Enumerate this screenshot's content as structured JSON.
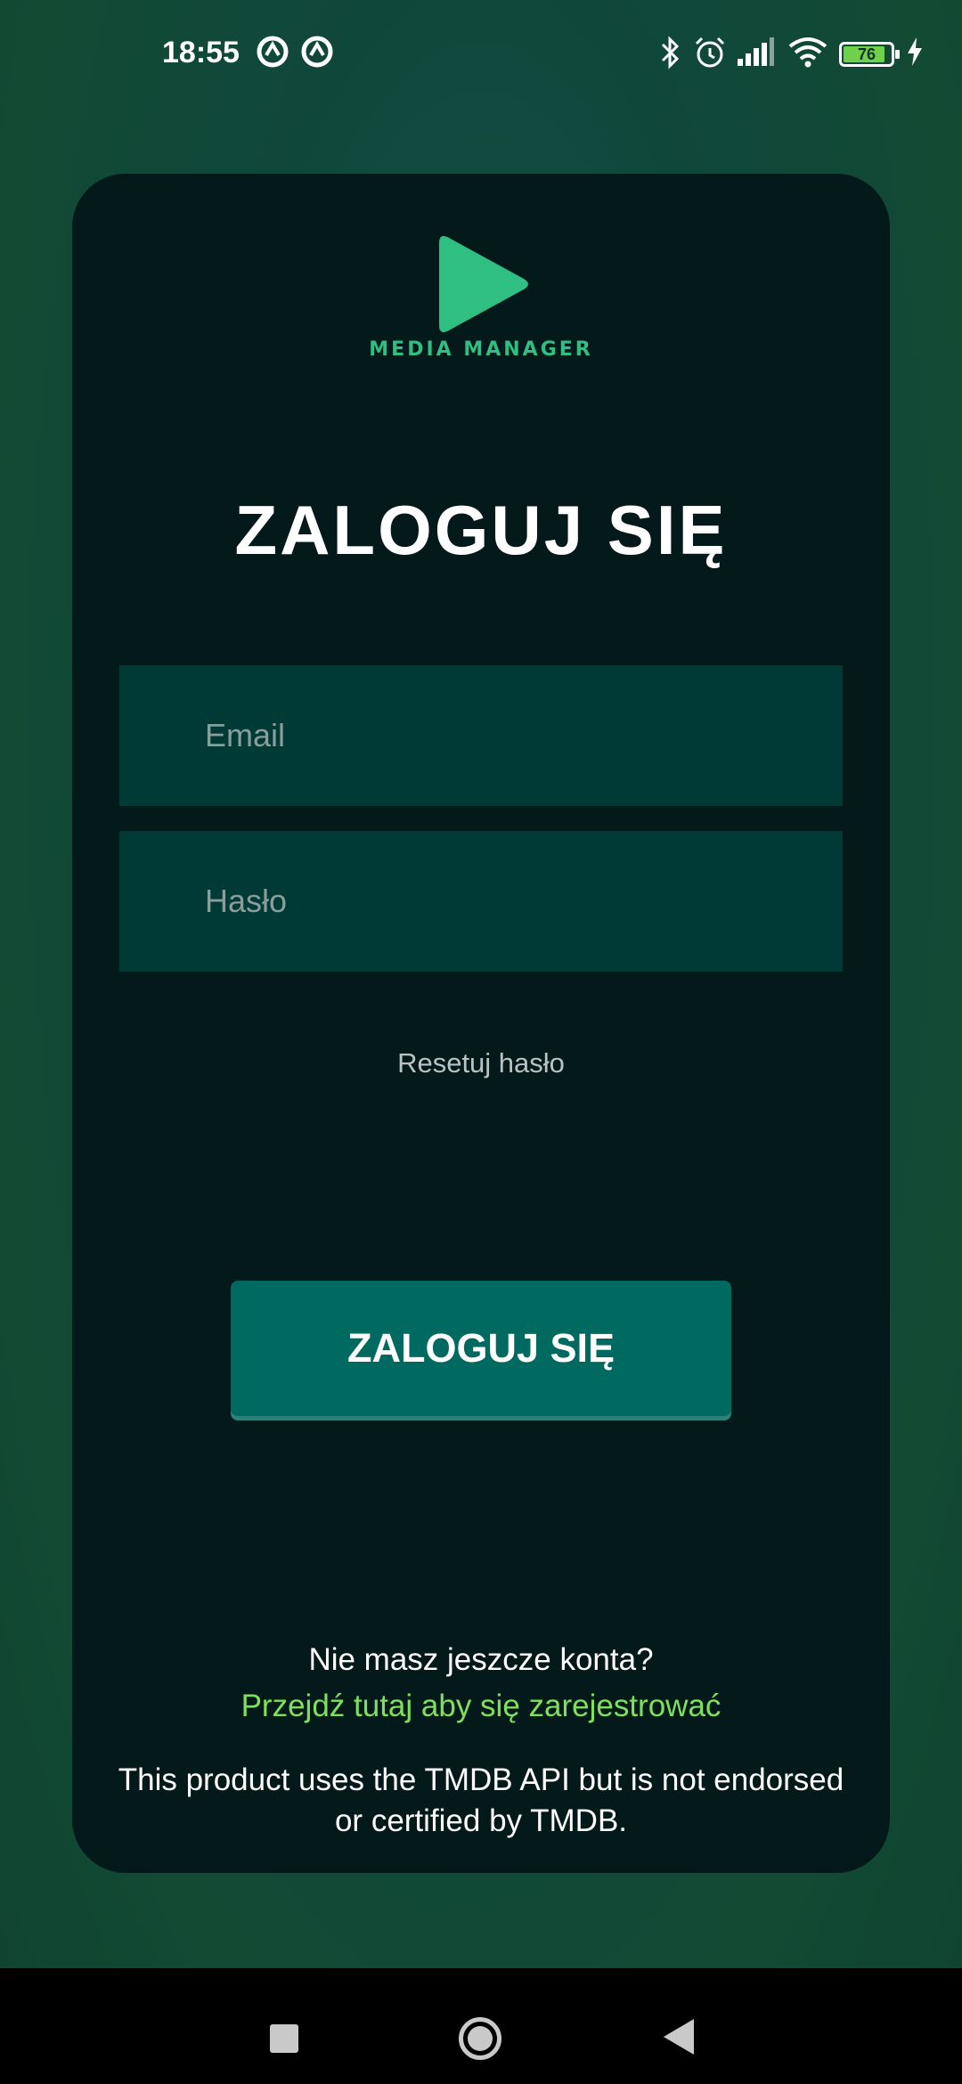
{
  "status_bar": {
    "time": "18:55",
    "battery_level": "76",
    "icons": [
      "notification-icon",
      "notification-icon",
      "bluetooth-icon",
      "alarm-icon",
      "signal-icon",
      "wifi-icon",
      "battery-icon",
      "charging-icon"
    ]
  },
  "logo": {
    "text": "MEDIA MANAGER",
    "color": "#2fbf83"
  },
  "login": {
    "title": "ZALOGUJ SIĘ",
    "email_placeholder": "Email",
    "password_placeholder": "Hasło",
    "reset_label": "Resetuj hasło",
    "submit_label": "ZALOGUJ SIĘ"
  },
  "register": {
    "prompt": "Nie masz jeszcze konta?",
    "link": "Przejdź tutaj aby się zarejestrować"
  },
  "disclaimer": "This product uses the TMDB API but is not endorsed or certified by TMDB.",
  "colors": {
    "card_background": "#04191a",
    "field_background": "#003a36",
    "button_background": "#006a61",
    "link_color": "#7fe05f"
  }
}
